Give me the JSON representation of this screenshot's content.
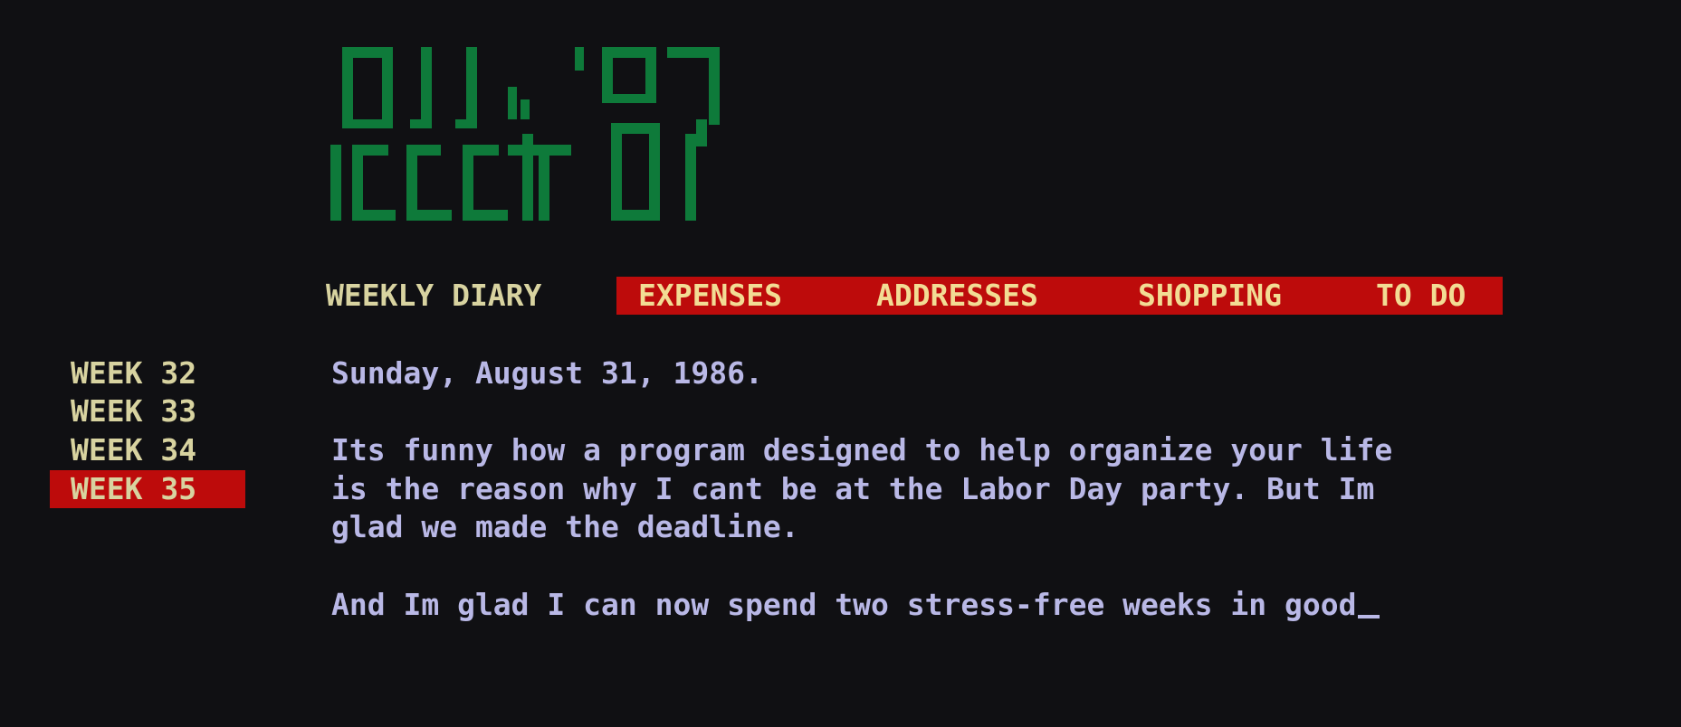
{
  "logo": {
    "text": "Addit '87",
    "color": "#0e7a3a"
  },
  "menu": {
    "weekly_diary": "WEEKLY DIARY",
    "expenses": "EXPENSES",
    "addresses": "ADDRESSES",
    "shopping": "SHOPPING",
    "todo": "TO DO",
    "highlight_color": "#bd0b0b"
  },
  "weeks": {
    "items": [
      {
        "label": "WEEK 32"
      },
      {
        "label": "WEEK 33"
      },
      {
        "label": "WEEK 34"
      },
      {
        "label": "WEEK 35"
      }
    ],
    "selected": "WEEK 35"
  },
  "diary": {
    "date": "Sunday, August 31, 1986.",
    "paragraph1": [
      "Its funny how a program designed to help organize your life",
      "is the reason why I cant be at the Labor Day party. But Im",
      "glad we made the deadline."
    ],
    "paragraph2": "And Im glad I can now spend two stress-free weeks in good",
    "text_color": "#b9b8e6"
  }
}
